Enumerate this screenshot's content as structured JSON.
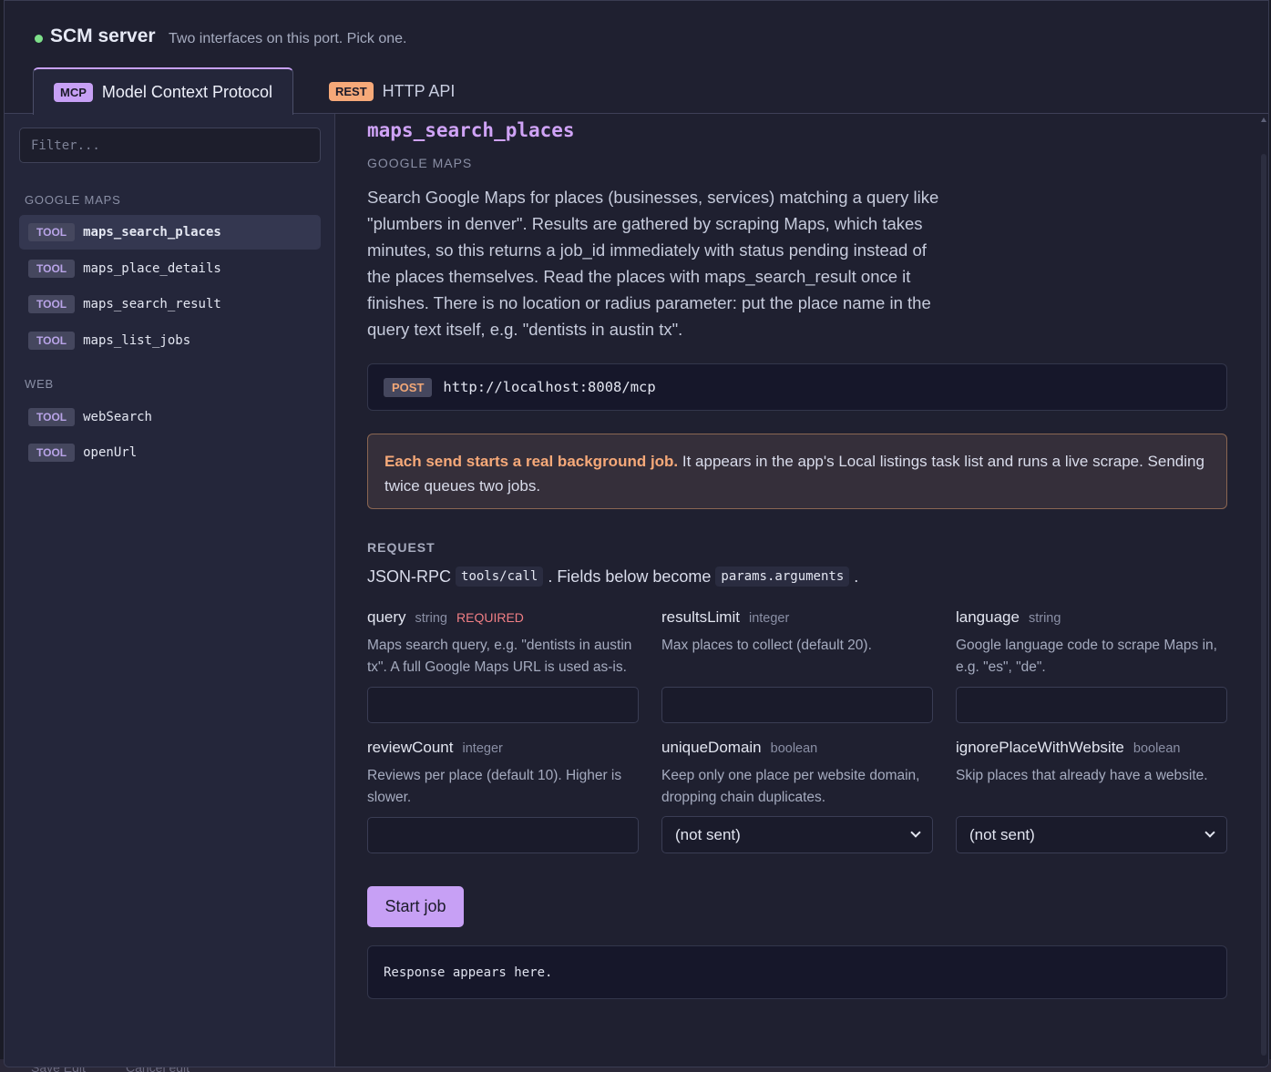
{
  "header": {
    "title": "SCM server",
    "subtitle": "Two interfaces on this port. Pick one."
  },
  "tabs": [
    {
      "badge": "MCP",
      "label": "Model Context Protocol",
      "active": true
    },
    {
      "badge": "REST",
      "label": "HTTP API",
      "active": false
    }
  ],
  "sidebar": {
    "filter_placeholder": "Filter...",
    "groups": [
      {
        "label": "GOOGLE MAPS",
        "items": [
          {
            "badge": "TOOL",
            "name": "maps_search_places",
            "selected": true
          },
          {
            "badge": "TOOL",
            "name": "maps_place_details",
            "selected": false
          },
          {
            "badge": "TOOL",
            "name": "maps_search_result",
            "selected": false
          },
          {
            "badge": "TOOL",
            "name": "maps_list_jobs",
            "selected": false
          }
        ]
      },
      {
        "label": "WEB",
        "items": [
          {
            "badge": "TOOL",
            "name": "webSearch",
            "selected": false
          },
          {
            "badge": "TOOL",
            "name": "openUrl",
            "selected": false
          }
        ]
      }
    ]
  },
  "main": {
    "tool_title": "maps_search_places",
    "tool_group": "GOOGLE MAPS",
    "description_lines": [
      "Search Google Maps for places (businesses, services) matching a query like",
      "\"plumbers in denver\". Results are gathered by scraping Maps, which takes",
      "minutes, so this returns a job_id immediately with status pending instead of",
      "the places themselves. Read the places with maps_search_result once it",
      "finishes. There is no location or radius parameter: put the place name in the",
      "query text itself, e.g. \"dentists in austin tx\"."
    ],
    "endpoint": {
      "method": "POST",
      "url": "http://localhost:8008/mcp"
    },
    "warning": {
      "bold": "Each send starts a real background job.",
      "text_line1": " It appears in the app's Local listings task list and runs a live scrape. Sending",
      "text_line2": "twice queues two jobs."
    },
    "request": {
      "label": "REQUEST",
      "prefix": "JSON-RPC",
      "method_code": "tools/call",
      "middle": ". Fields below become",
      "args_code": "params.arguments",
      "suffix": "."
    },
    "fields": [
      {
        "name": "query",
        "type": "string",
        "required": "REQUIRED",
        "help_lines": [
          "Maps search query, e.g. \"dentists in austin",
          "tx\". A full Google Maps URL is used as-is."
        ],
        "value": ""
      },
      {
        "name": "resultsLimit",
        "type": "integer",
        "required": "",
        "help_lines": [
          "Max places to collect (default 20).",
          ""
        ],
        "value": ""
      },
      {
        "name": "language",
        "type": "string",
        "required": "",
        "help_lines": [
          "Google language code to scrape Maps in,",
          "e.g. \"es\", \"de\"."
        ],
        "value": ""
      },
      {
        "name": "reviewCount",
        "type": "integer",
        "required": "",
        "help_lines": [
          "Reviews per place (default 10). Higher is",
          "slower."
        ],
        "value": ""
      },
      {
        "name": "uniqueDomain",
        "type": "boolean",
        "required": "",
        "help_lines": [
          "Keep only one place per website domain,",
          "dropping chain duplicates."
        ],
        "value": "(not sent)"
      },
      {
        "name": "ignorePlaceWithWebsite",
        "type": "boolean",
        "required": "",
        "help_lines": [
          "Skip places that already have a website.",
          ""
        ],
        "value": "(not sent)"
      }
    ],
    "start_button": "Start job",
    "response_placeholder": "Response appears here."
  },
  "background": {
    "ghost_left": "Save Edit",
    "ghost_right": "Cancel edit"
  },
  "colors": {
    "accent": "#c7a0f5",
    "rest_accent": "#f6a979",
    "status_ok": "#7ee08a",
    "required": "#f17f85"
  }
}
